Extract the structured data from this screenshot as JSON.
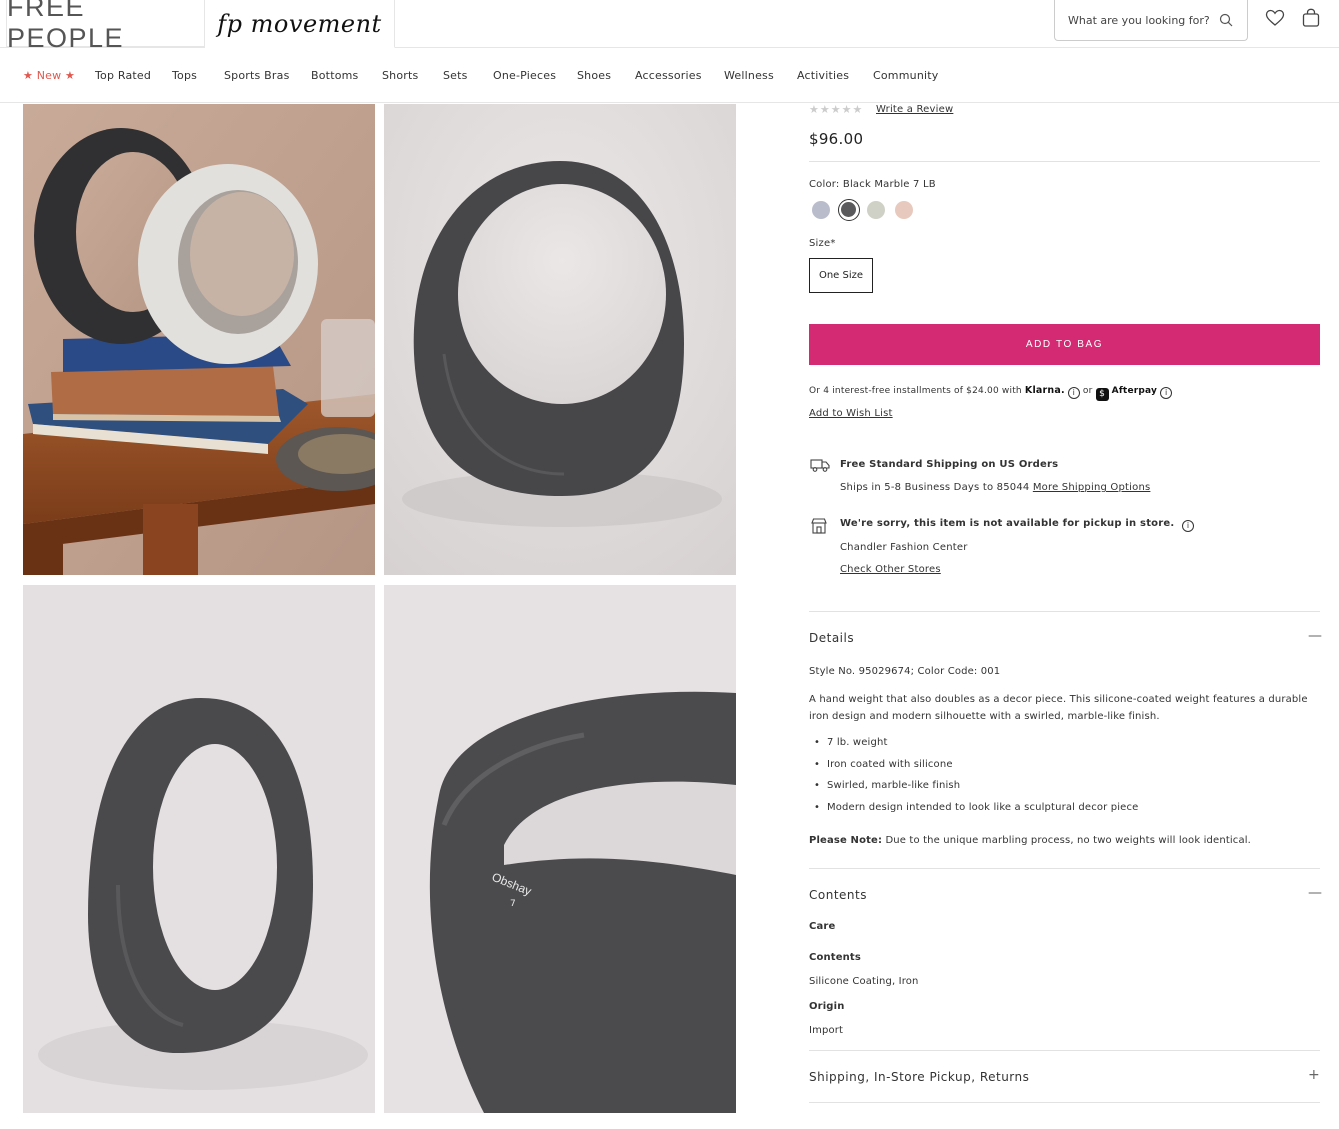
{
  "header": {
    "logo": "FREE PEOPLE",
    "sub_logo": "fp movement",
    "search_placeholder": "What are you looking for?"
  },
  "nav": {
    "items": [
      "★ New ★",
      "Top Rated",
      "Tops",
      "Sports Bras",
      "Bottoms",
      "Shorts",
      "Sets",
      "One-Pieces",
      "Shoes",
      "Accessories",
      "Wellness",
      "Activities",
      "Community"
    ]
  },
  "gallery": {
    "engraving": "Obshay",
    "engraving_number": "7"
  },
  "product": {
    "stars": "★★★★★",
    "write_review": "Write a Review",
    "price": "$96.00",
    "color_label": "Color: Black Marble 7 LB",
    "swatch_colors": [
      "#b9bccb",
      "#5a5a5c",
      "#cfd1c6",
      "#e8c9bd"
    ],
    "size_label": "Size*",
    "size_option": "One Size",
    "add_to_bag": "ADD TO BAG",
    "installments_prefix": "Or 4 interest-free installments of $24.00 with",
    "klarna": "Klarna.",
    "or": "or",
    "afterpay": "Afterpay",
    "wishlist": "Add to Wish List",
    "shipping_title": "Free Standard Shipping on US Orders",
    "shipping_detail": "Ships in 5-8 Business Days to 85044",
    "shipping_link": "More Shipping Options",
    "pickup_title": "We're sorry, this item is not available for pickup in store.",
    "pickup_store": "Chandler Fashion Center",
    "pickup_link": "Check Other Stores"
  },
  "details": {
    "title": "Details",
    "style_no": "Style No. 95029674; Color Code: 001",
    "description": "A hand weight that also doubles as a decor piece. This silicone-coated weight features a durable iron design and modern silhouette with a swirled, marble-like finish.",
    "bullets": [
      "7 lb. weight",
      "Iron coated with silicone",
      "Swirled, marble-like finish",
      "Modern design intended to look like a sculptural decor piece"
    ],
    "note_label": "Please Note:",
    "note_text": "Due to the unique marbling process, no two weights will look identical."
  },
  "contents": {
    "title": "Contents",
    "care_label": "Care",
    "contents_label": "Contents",
    "contents_value": "Silicone Coating, Iron",
    "origin_label": "Origin",
    "origin_value": "Import"
  },
  "shipping_section": {
    "title": "Shipping, In-Store Pickup, Returns"
  },
  "colors": {
    "accent": "#d42a74",
    "new_label": "#e0584e"
  }
}
